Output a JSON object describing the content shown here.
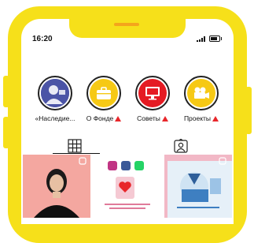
{
  "status_bar": {
    "time": "16:20"
  },
  "highlights": [
    {
      "label": "«Наследие...",
      "icon": "portrait-icon",
      "has_alert": false,
      "color": "#3a3f8f"
    },
    {
      "label": "О Фонде",
      "icon": "briefcase-icon",
      "has_alert": true,
      "color": "#f6c915"
    },
    {
      "label": "Советы",
      "icon": "monitor-icon",
      "has_alert": true,
      "color": "#e51b23"
    },
    {
      "label": "Проекты",
      "icon": "camera-icon",
      "has_alert": true,
      "color": "#f6c915"
    }
  ],
  "tabs": [
    {
      "name": "grid-tab",
      "icon": "grid-icon"
    },
    {
      "name": "tagged-tab",
      "icon": "tagged-person-icon"
    }
  ],
  "colors": {
    "phone_frame": "#f6e01a",
    "alert": "#e8262a",
    "tile1_bg": "#f7b9b4",
    "tile2_bg": "#ffffff",
    "tile3_bg": "#e9f2fa"
  }
}
